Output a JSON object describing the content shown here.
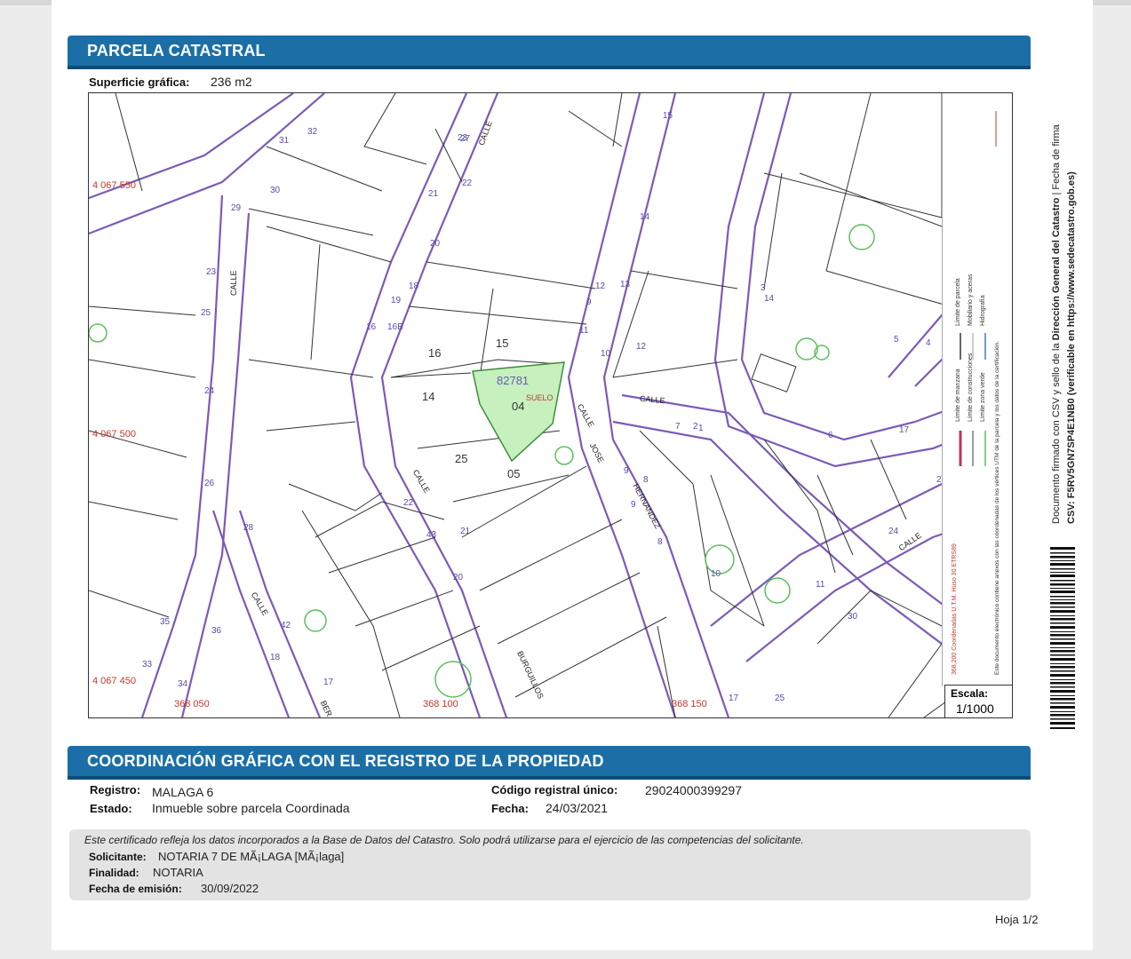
{
  "section1": {
    "title": "PARCELA CATASTRAL"
  },
  "surface": {
    "label": "Superficie gráfica:",
    "value": "236 m2"
  },
  "map": {
    "parcel_ref": "82781",
    "parcel_sub": "SUELO",
    "parcel_number": "04",
    "lot_labels": [
      "16",
      "15",
      "14",
      "25",
      "05"
    ],
    "street_labels": [
      "CALLE",
      "CALLE",
      "CALLE",
      "CALLE",
      "CALLE",
      "CALLE",
      "CALLE"
    ],
    "street_names": [
      "JOSE",
      "HERNANDEZ",
      "BURGUILLOS",
      "BER"
    ],
    "house_numbers": [
      "31",
      "32",
      "30",
      "29",
      "23",
      "25",
      "24",
      "26",
      "28",
      "27",
      "23",
      "22",
      "21",
      "20",
      "18",
      "19",
      "16",
      "16B",
      "15",
      "14",
      "13",
      "12",
      "11",
      "10",
      "9",
      "8",
      "7",
      "6",
      "5",
      "4",
      "3",
      "2",
      "1",
      "17",
      "18",
      "33",
      "34",
      "35",
      "36",
      "42",
      "43",
      "20",
      "21",
      "22",
      "9",
      "12",
      "14",
      "17",
      "8",
      "9",
      "10",
      "11",
      "17",
      "24",
      "26",
      "30",
      "25"
    ],
    "coord_labels": [
      "4 067 550",
      "4 067 500",
      "4 067 450",
      "368 050",
      "368 100",
      "368 150"
    ],
    "legend": [
      "Límite de manzana",
      "Límite de parcela",
      "Límite de construcciones",
      "Mobiliario y aceras",
      "Límite zona verde",
      "Hidrografía"
    ],
    "legend_note": "Este documento electrónico contiene anexos con las coordenadas de los vértices UTM de la parcela y los datos de la certificación.",
    "legend_coords": "368,200 Coordenadas U.T.M. Huso 30 ETRS89"
  },
  "scale": {
    "label": "Escala:",
    "value": "1/1000"
  },
  "section2": {
    "title": "COORDINACIÓN GRÁFICA CON EL REGISTRO DE LA PROPIEDAD"
  },
  "registry": {
    "registro_label": "Registro:",
    "registro_value": "MALAGA 6",
    "estado_label": "Estado:",
    "estado_value": "Inmueble sobre parcela Coordinada",
    "codigo_label": "Código registral único:",
    "codigo_value": "29024000399297",
    "fecha_label": "Fecha:",
    "fecha_value": "24/03/2021"
  },
  "footer": {
    "disclaimer": "Este certificado refleja los datos incorporados a la Base de Datos del Catastro. Solo podrá utilizarse para el ejercicio de las competencias del solicitante.",
    "solicitante_label": "Solicitante:",
    "solicitante_value": "NOTARIA 7 DE MÃ¡LAGA [MÃ¡laga]",
    "finalidad_label": "Finalidad:",
    "finalidad_value": "NOTARIA",
    "emision_label": "Fecha de emisión:",
    "emision_value": "30/09/2022"
  },
  "side": {
    "line1_prefix": "Documento firmado con CSV y sello de la",
    "line1_bold": "Dirección General del Catastro",
    "line1_suffix": "| Fecha de firma",
    "line2": "CSV: F5RV5GN7SP4E1NB0 (verificable en https://www.sedecatastro.gob.es)"
  },
  "page": {
    "number": "Hoja 1/2"
  },
  "colors": {
    "header": "#1b6fa6",
    "parcel_fill": "#c6f0bd",
    "street_line": "#7b5bb8",
    "coord_text": "#c0392b"
  }
}
